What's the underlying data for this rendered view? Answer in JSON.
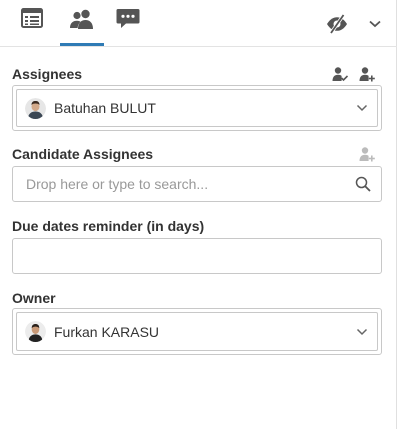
{
  "tabs": [
    {
      "name": "list",
      "icon": "list-icon"
    },
    {
      "name": "people",
      "icon": "people-icon",
      "active": true
    },
    {
      "name": "comments",
      "icon": "comments-icon"
    }
  ],
  "header_actions": {
    "visibility_icon": "eye-off-icon",
    "menu_icon": "chevron-down-icon"
  },
  "assignees": {
    "label": "Assignees",
    "selected": "Batuhan BULUT",
    "actions": [
      "assign-self-icon",
      "add-user-icon"
    ]
  },
  "candidate_assignees": {
    "label": "Candidate Assignees",
    "placeholder": "Drop here or type to search...",
    "value": ""
  },
  "due_dates_reminder": {
    "label": "Due dates reminder (in days)",
    "value": ""
  },
  "owner": {
    "label": "Owner",
    "selected": "Furkan KARASU"
  },
  "colors": {
    "accent": "#2f7bb5",
    "icon": "#555555",
    "icon_disabled": "#bbbbbb",
    "border": "#c8c8c8"
  }
}
